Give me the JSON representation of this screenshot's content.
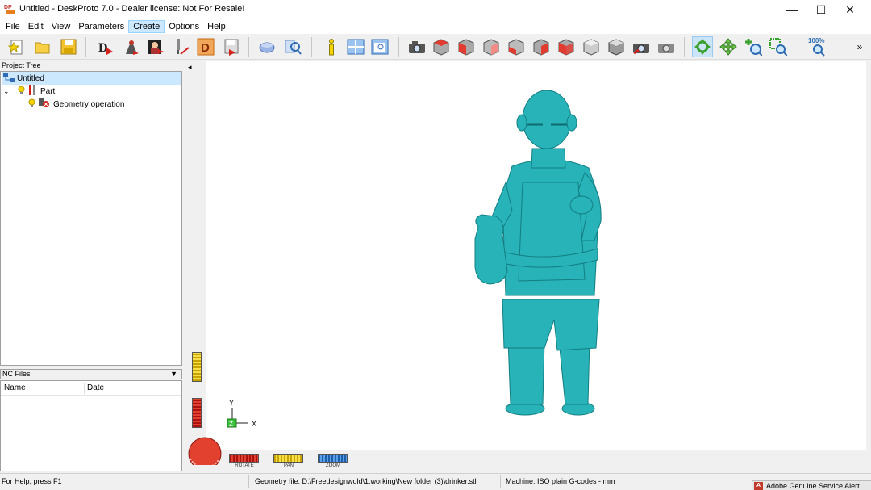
{
  "window": {
    "title": "Untitled - DeskProto 7.0 - Dealer license: Not For Resale!",
    "icon_text": "DP",
    "minimize_glyph": "—",
    "maximize_glyph": "☐",
    "close_glyph": "✕"
  },
  "menu": {
    "items": [
      "File",
      "Edit",
      "View",
      "Parameters",
      "Create",
      "Options",
      "Help"
    ],
    "active": "Create"
  },
  "toolbar": {
    "zoom_percent_label": "100%",
    "overflow_glyph": "»"
  },
  "project_tree": {
    "header": "Project Tree",
    "root": "Untitled",
    "part": "Part",
    "operation": "Geometry operation"
  },
  "nc_files": {
    "header": "NC Files",
    "col_name": "Name",
    "col_date": "Date"
  },
  "viewport": {
    "collapse_glyph": "◂",
    "axis_y": "Y",
    "axis_z": "Z",
    "axis_x": "X",
    "model_color": "#27b3b8",
    "dial_rotate": "ROTATE",
    "dial_pan": "PAN",
    "dial_zoom": "ZOOM"
  },
  "status": {
    "help": "For Help, press F1",
    "geometry_file": "Geometry file: D:\\Freedesignwold\\1.working\\New folder (3)\\drinker.stl",
    "machine": "Machine: ISO plain G-codes - mm"
  },
  "taskbar_alert": {
    "logo": "A",
    "text": "Adobe Genuine Service Alert"
  }
}
